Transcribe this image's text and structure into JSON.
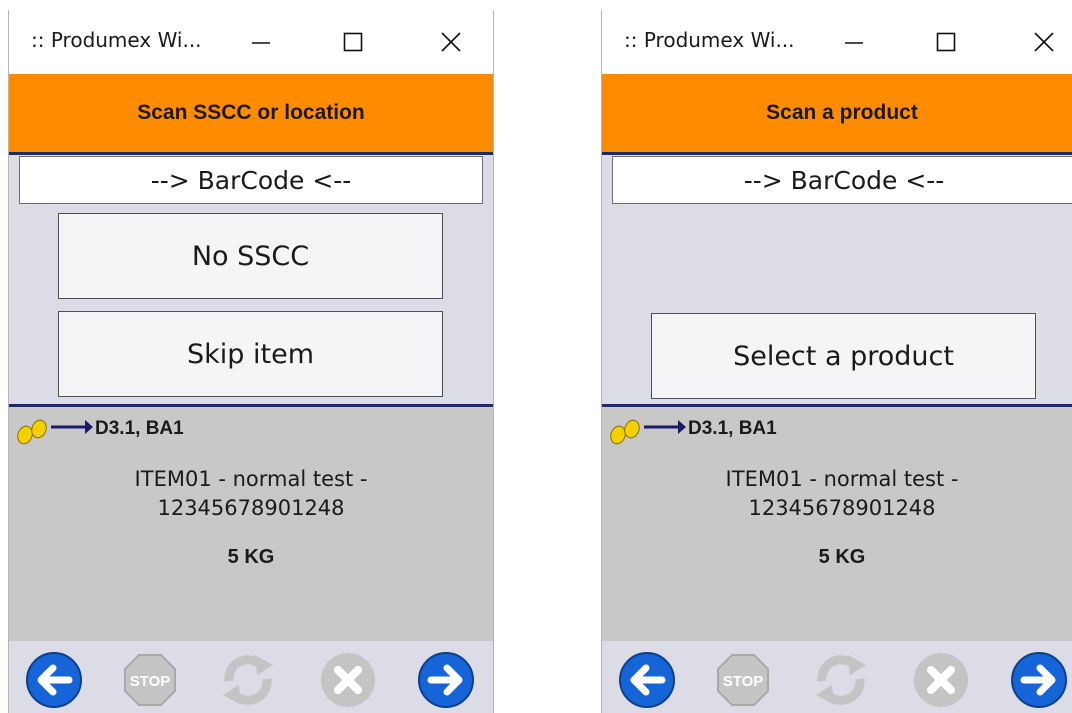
{
  "windows": [
    {
      "title": ":: Produmex Wi...",
      "header": "Scan SSCC or location",
      "barcode": "--> BarCode <--",
      "buttons": [
        "No SSCC",
        "Skip item"
      ],
      "location": "D3.1, BA1",
      "item_line1": "ITEM01 - normal test -",
      "item_line2": "12345678901248",
      "quantity": "5 KG"
    },
    {
      "title": ":: Produmex Wi...",
      "header": "Scan a product",
      "barcode": "--> BarCode <--",
      "buttons": [
        "Select a product"
      ],
      "location": "D3.1, BA1",
      "item_line1": "ITEM01 - normal test -",
      "item_line2": "12345678901248",
      "quantity": "5 KG"
    }
  ],
  "icons": {
    "back": "arrow-left-icon",
    "stop": "stop-icon",
    "refresh": "refresh-icon",
    "cancel": "cancel-icon",
    "next": "arrow-right-icon",
    "route": "footsteps-icon"
  },
  "colors": {
    "header_bg": "#ff8c00",
    "divider": "#1f2a6a",
    "nav_blue": "#1565d8",
    "disabled_gray": "#c4c4c4"
  }
}
